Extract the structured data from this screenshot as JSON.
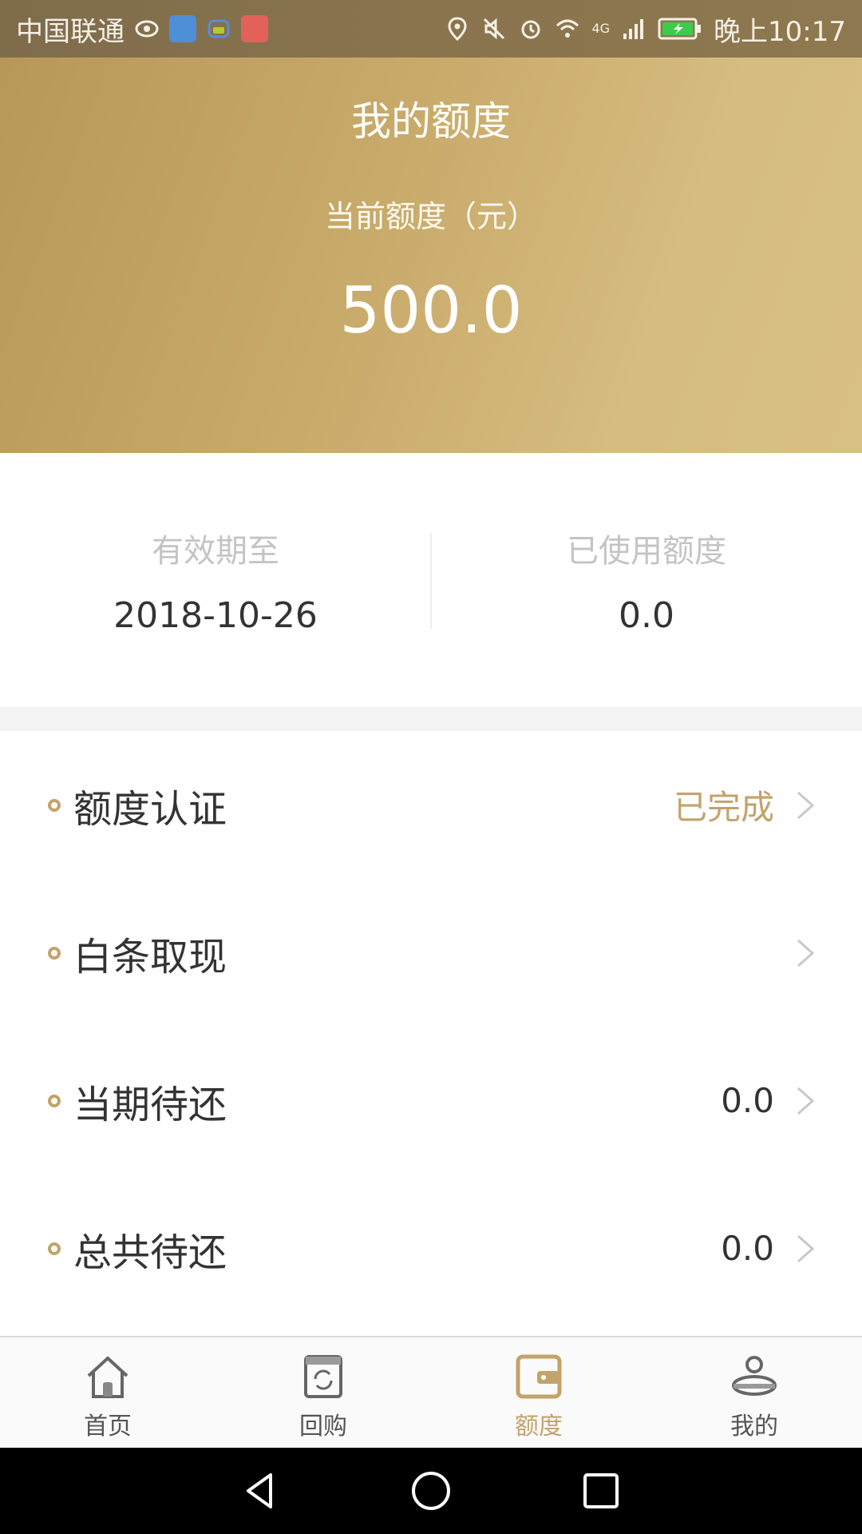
{
  "status_bar": {
    "carrier": "中国联通",
    "time": "晚上10:17",
    "network": "4G"
  },
  "header": {
    "title": "我的额度",
    "subtitle": "当前额度（元）",
    "amount": "500.0"
  },
  "info": {
    "left_label": "有效期至",
    "left_value": "2018-10-26",
    "right_label": "已使用额度",
    "right_value": "0.0"
  },
  "list": {
    "items": [
      {
        "label": "额度认证",
        "value": "已完成"
      },
      {
        "label": "白条取现",
        "value": ""
      },
      {
        "label": "当期待还",
        "value": "0.0"
      },
      {
        "label": "总共待还",
        "value": "0.0"
      }
    ]
  },
  "bottom_nav": {
    "items": [
      {
        "label": "首页",
        "icon": "home-icon"
      },
      {
        "label": "回购",
        "icon": "buyback-icon"
      },
      {
        "label": "额度",
        "icon": "wallet-icon",
        "active": true
      },
      {
        "label": "我的",
        "icon": "profile-icon"
      }
    ]
  },
  "colors": {
    "accent": "#c3a36a",
    "header_start": "#b89858",
    "header_end": "#d8bf84"
  }
}
